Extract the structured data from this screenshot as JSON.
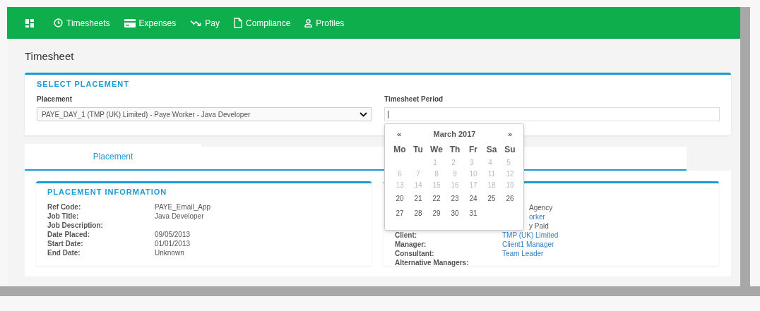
{
  "nav": {
    "items": [
      {
        "kind": "dashboard"
      },
      {
        "kind": "clock",
        "label": "Timesheets"
      },
      {
        "kind": "card",
        "label": "Expenses"
      },
      {
        "kind": "trend",
        "label": "Pay"
      },
      {
        "kind": "file",
        "label": "Compliance"
      },
      {
        "kind": "person",
        "label": "Profiles"
      }
    ]
  },
  "page_title": "Timesheet",
  "select_placement": {
    "title": "SELECT PLACEMENT",
    "placement_label": "Placement",
    "placement_value": "PAYE_DAY_1 (TMP (UK) Limited) - Paye Worker - Java Developer",
    "period_label": "Timesheet Period"
  },
  "datepicker": {
    "prev": "«",
    "month": "March 2017",
    "next": "»",
    "weekdays": [
      "Mo",
      "Tu",
      "We",
      "Th",
      "Fr",
      "Sa",
      "Su"
    ],
    "weeks": [
      {
        "days": [
          {
            "day": "1",
            "disabled": true
          },
          {
            "day": "2",
            "disabled": true
          },
          {
            "day": "3",
            "disabled": true
          },
          {
            "day": "4",
            "disabled": true
          },
          {
            "day": "5",
            "disabled": true
          }
        ]
      },
      {
        "days": [
          {
            "day": "6",
            "disabled": true
          },
          {
            "day": "7",
            "disabled": true
          },
          {
            "day": "8",
            "disabled": true
          },
          {
            "day": "9",
            "disabled": true
          },
          {
            "day": "10",
            "disabled": true
          },
          {
            "day": "11",
            "disabled": true
          },
          {
            "day": "12",
            "disabled": true
          }
        ]
      },
      {
        "days": [
          {
            "day": "13",
            "disabled": true
          },
          {
            "day": "14",
            "disabled": true
          },
          {
            "day": "15",
            "disabled": true
          },
          {
            "day": "16",
            "disabled": true
          },
          {
            "day": "17",
            "disabled": true
          },
          {
            "day": "18",
            "disabled": true
          },
          {
            "day": "19",
            "disabled": true
          }
        ]
      },
      {
        "days": [
          {
            "day": "20",
            "disabled": false
          },
          {
            "day": "21",
            "disabled": false
          },
          {
            "day": "22",
            "disabled": false
          },
          {
            "day": "23",
            "disabled": false
          },
          {
            "day": "24",
            "disabled": false
          },
          {
            "day": "25",
            "disabled": false
          },
          {
            "day": "26",
            "disabled": false
          }
        ]
      },
      {
        "days": [
          {
            "day": "27",
            "disabled": false
          },
          {
            "day": "28",
            "disabled": false
          },
          {
            "day": "29",
            "disabled": false
          },
          {
            "day": "30",
            "disabled": false
          },
          {
            "day": "31",
            "disabled": false
          }
        ]
      }
    ]
  },
  "tabs": [
    {
      "label": "Placement",
      "selected": true
    }
  ],
  "placement_information": {
    "title": "PLACEMENT INFORMATION",
    "rows": [
      {
        "label": "Ref Code:",
        "value": "PAYE_Email_App"
      },
      {
        "label": "Job Title:",
        "value": "Java Developer"
      },
      {
        "label": "Job Description:"
      },
      {
        "label": "Date Placed:",
        "value": "09/05/2013"
      },
      {
        "label": "Start Date:",
        "value": "01/01/2013"
      },
      {
        "label": "End Date:",
        "value": "Unknown"
      }
    ]
  },
  "second_card": {
    "rows": [
      {
        "value": "Agency",
        "link": false
      },
      {
        "value": "orker",
        "link": true
      },
      {
        "value": "y Paid",
        "link": false
      },
      {
        "label": "Client:",
        "value": "TMP (UK) Limited",
        "link": true
      },
      {
        "label": "Manager:",
        "value": "Client1 Manager",
        "link": true
      },
      {
        "label": "Consultant:",
        "value": "Team Leader",
        "link": true
      },
      {
        "label": "Alternative Managers:"
      }
    ]
  }
}
